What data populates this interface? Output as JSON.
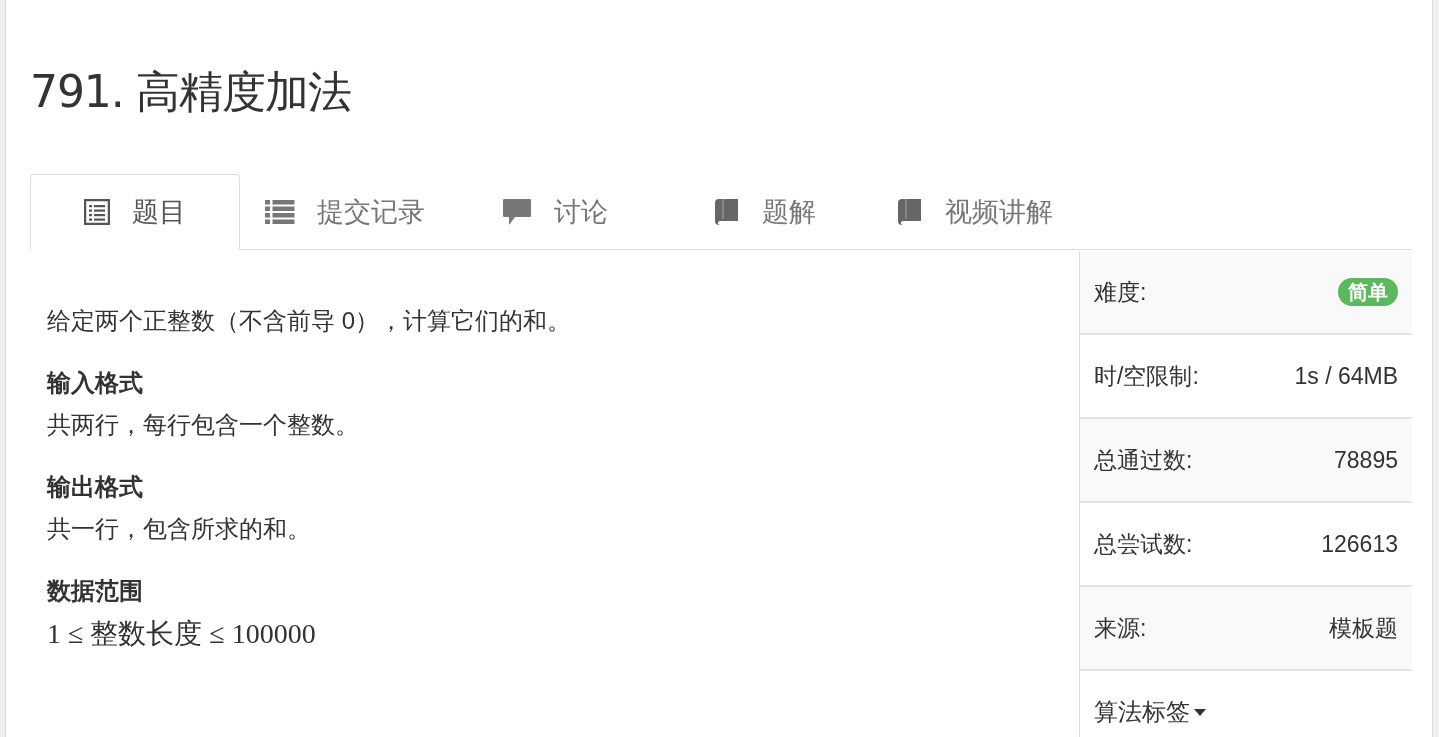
{
  "title": "791. 高精度加法",
  "tabs": [
    {
      "label": "题目",
      "selected": true
    },
    {
      "label": "提交记录",
      "selected": false
    },
    {
      "label": "讨论",
      "selected": false
    },
    {
      "label": "题解",
      "selected": false
    },
    {
      "label": "视频讲解",
      "selected": false
    }
  ],
  "content": [
    {
      "kind": "paragraph",
      "text": "给定两个正整数（不含前导 0），计算它们的和。"
    },
    {
      "kind": "heading",
      "text": "输入格式"
    },
    {
      "kind": "paragraph",
      "text": "共两行，每行包含一个整数。"
    },
    {
      "kind": "heading",
      "text": "输出格式"
    },
    {
      "kind": "paragraph",
      "text": "共一行，包含所求的和。"
    },
    {
      "kind": "heading",
      "text": "数据范围"
    },
    {
      "kind": "math",
      "text": "1 ≤ 整数长度 ≤ 100000"
    }
  ],
  "info": [
    {
      "kind": "badge",
      "label": "难度:",
      "value": "简单",
      "color": "#5cb85c"
    },
    {
      "kind": "text",
      "label": "时/空限制:",
      "value": "1s / 64MB"
    },
    {
      "kind": "text",
      "label": "总通过数:",
      "value": "78895"
    },
    {
      "kind": "text",
      "label": "总尝试数:",
      "value": "126613"
    },
    {
      "kind": "text",
      "label": "来源:",
      "value": "模板题"
    },
    {
      "kind": "dropdown",
      "label": "算法标签"
    }
  ]
}
